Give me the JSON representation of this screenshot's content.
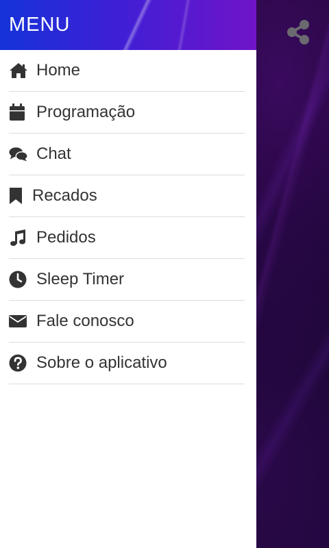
{
  "drawer": {
    "title": "MENU",
    "items": [
      {
        "label": "Home",
        "icon": "home-icon"
      },
      {
        "label": "Programação",
        "icon": "calendar-icon"
      },
      {
        "label": "Chat",
        "icon": "comments-icon"
      },
      {
        "label": "Recados",
        "icon": "bookmark-icon"
      },
      {
        "label": "Pedidos",
        "icon": "music-icon"
      },
      {
        "label": "Sleep Timer",
        "icon": "clock-icon"
      },
      {
        "label": "Fale conosco",
        "icon": "envelope-icon"
      },
      {
        "label": "Sobre o aplicativo",
        "icon": "question-circle-icon"
      }
    ]
  },
  "toolbar": {
    "share_icon": "share-icon"
  },
  "colors": {
    "header_start": "#1533d8",
    "header_end": "#7014c8",
    "icon": "#333333",
    "text": "#333333",
    "divider": "#dcdcdc",
    "background_dark": "#0e0320"
  }
}
